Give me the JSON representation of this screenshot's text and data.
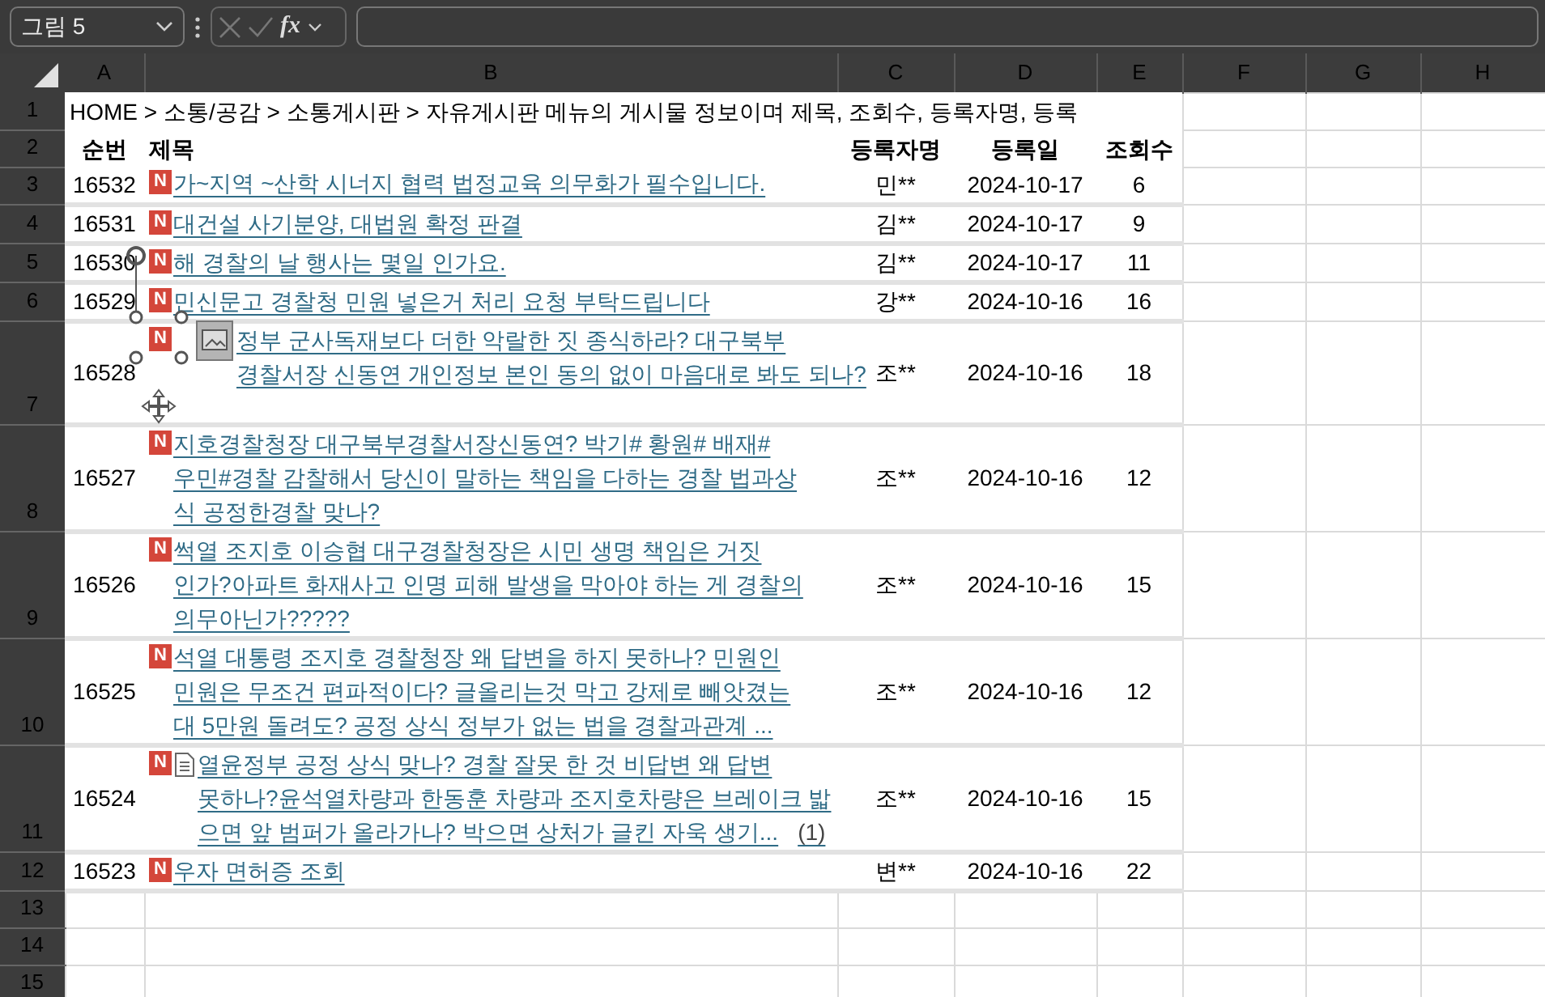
{
  "name_box": {
    "value": "그림 5"
  },
  "formula_bar": {
    "function_label": "fx"
  },
  "columns": [
    "A",
    "B",
    "C",
    "D",
    "E",
    "F",
    "G",
    "H"
  ],
  "row_numbers": [
    "1",
    "2",
    "3",
    "4",
    "5",
    "6",
    "7",
    "8",
    "9",
    "10",
    "11",
    "12",
    "13",
    "14",
    "15"
  ],
  "breadcrumb": "HOME > 소통/공감 > 소통게시판 > 자유게시판 메뉴의 게시물 정보이며 제목, 조회수, 등록자명, 등록",
  "headers": [
    "순번",
    "제목",
    "등록자명",
    "등록일",
    "조회수"
  ],
  "posts": [
    {
      "no": "16532",
      "badge": "N",
      "attachment": false,
      "picture_selected": false,
      "title_lines": [
        "가~지역 ~산학 시너지 협력 법정교육 의무화가 필수입니다."
      ],
      "author": "민**",
      "date": "2024-10-17",
      "views": "6"
    },
    {
      "no": "16531",
      "badge": "N",
      "attachment": false,
      "picture_selected": false,
      "title_lines": [
        "대건설 사기분양, 대법원 확정 판결"
      ],
      "author": "김**",
      "date": "2024-10-17",
      "views": "9"
    },
    {
      "no": "16530",
      "badge": "N",
      "attachment": false,
      "picture_selected": false,
      "title_lines": [
        "해 경찰의 날 행사는 몇일 인가요."
      ],
      "author": "김**",
      "date": "2024-10-17",
      "views": "11"
    },
    {
      "no": "16529",
      "badge": "N",
      "attachment": false,
      "picture_selected": false,
      "title_lines": [
        "민신문고 경찰청 민원 넣은거 처리 요청 부탁드립니다"
      ],
      "author": "강**",
      "date": "2024-10-16",
      "views": "16"
    },
    {
      "no": "16528",
      "badge": "N",
      "attachment": false,
      "picture_selected": true,
      "title_lines": [
        "정부 군사독재보다 더한 악랄한 짓 종식하라? 대구북부",
        "경찰서장 신동연 개인정보 본인 동의 없이 마음대로 봐도 되나?"
      ],
      "author": "조**",
      "date": "2024-10-16",
      "views": "18"
    },
    {
      "no": "16527",
      "badge": "N",
      "attachment": false,
      "picture_selected": false,
      "title_lines": [
        "지호경찰청장 대구북부경찰서장신동연? 박기# 황원# 배재#",
        "우민#경찰 감찰해서 당신이 말하는 책임을 다하는 경찰 법과상",
        "식 공정한경찰 맞나?"
      ],
      "author": "조**",
      "date": "2024-10-16",
      "views": "12"
    },
    {
      "no": "16526",
      "badge": "N",
      "attachment": false,
      "picture_selected": false,
      "title_lines": [
        "썩열 조지호 이승협 대구경찰청장은 시민 생명 책임은 거짓",
        "인가?아파트 화재사고 인명 피해 발생을 막아야 하는 게 경찰의",
        "의무아닌가?????"
      ],
      "author": "조**",
      "date": "2024-10-16",
      "views": "15"
    },
    {
      "no": "16525",
      "badge": "N",
      "attachment": false,
      "picture_selected": false,
      "title_lines": [
        "석열 대통령 조지호 경찰청장 왜 답변을 하지 못하나? 민원인",
        "민원은 무조건 편파적이다? 글올리는것 막고 강제로 빼앗겼는",
        "대 5만원 돌려도? 공정 상식 정부가 없는 법을 경찰과관계 ..."
      ],
      "author": "조**",
      "date": "2024-10-16",
      "views": "12"
    },
    {
      "no": "16524",
      "badge": "N",
      "attachment": true,
      "picture_selected": false,
      "title_lines": [
        "열윤정부 공정 상식 맞나? 경찰 잘못 한 것 비답변 왜 답변",
        "못하나?윤석열차량과 한동훈 차량과 조지호차량은 브레이크 밟",
        "으면 앞 범퍼가 올라가나? 박으면 상처가 글킨 자욱 생기..."
      ],
      "comment_count": "(1)",
      "author": "조**",
      "date": "2024-10-16",
      "views": "15"
    },
    {
      "no": "16523",
      "badge": "N",
      "attachment": false,
      "picture_selected": false,
      "title_lines": [
        "우자 면허증 조회"
      ],
      "author": "변**",
      "date": "2024-10-16",
      "views": "22"
    }
  ]
}
